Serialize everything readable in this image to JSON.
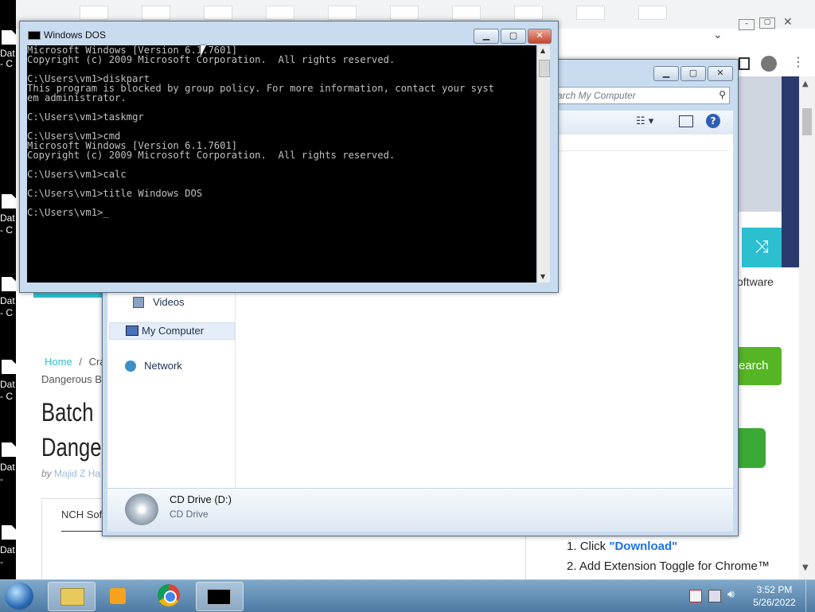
{
  "desktop": {
    "labels": [
      "Dat",
      "- C",
      "Dat",
      "- C",
      "Dat",
      "- C",
      "Dat",
      "- C",
      "Dat",
      "-",
      "Dat",
      "-"
    ]
  },
  "browser": {
    "breadcrumb_home": "Home",
    "breadcrumb_sep": "/",
    "breadcrumb_current": "Cra",
    "breadcrumb_line2": "Dangerous B",
    "title_line1": "Batch",
    "title_line2": "Dange",
    "byline_by": "by",
    "byline_author": "Majid Z Ha",
    "tab_label": "NCH Sof",
    "side_software": "oftware",
    "search_button": "earch",
    "steps": [
      {
        "num": "1.",
        "text": "Click ",
        "link": "\"Download\""
      },
      {
        "num": "2.",
        "text": "Add Extension Toggle for Chrome™",
        "link": ""
      }
    ]
  },
  "explorer": {
    "search_placeholder": "arch My Computer",
    "nav_items": [
      "Videos",
      "My Computer",
      "Network"
    ],
    "drive_name": "CD Drive (D:)",
    "drive_type": "CD Drive"
  },
  "console": {
    "title": "Windows DOS",
    "lines": [
      "Microsoft Windows [Version 6.1.7601]",
      "Copyright (c) 2009 Microsoft Corporation.  All rights reserved.",
      "",
      "C:\\Users\\vm1>diskpart",
      "This program is blocked by group policy. For more information, contact your syst",
      "em administrator.",
      "",
      "C:\\Users\\vm1>taskmgr",
      "",
      "C:\\Users\\vm1>cmd",
      "Microsoft Windows [Version 6.1.7601]",
      "Copyright (c) 2009 Microsoft Corporation.  All rights reserved.",
      "",
      "C:\\Users\\vm1>calc",
      "",
      "C:\\Users\\vm1>title Windows DOS",
      "",
      "C:\\Users\\vm1>_"
    ]
  },
  "taskbar": {
    "time": "3:52 PM",
    "date": "5/26/2022"
  },
  "colors": {
    "accent_teal": "#2bbfd0",
    "accent_green": "#56b524",
    "link_blue": "#1a73e8"
  }
}
